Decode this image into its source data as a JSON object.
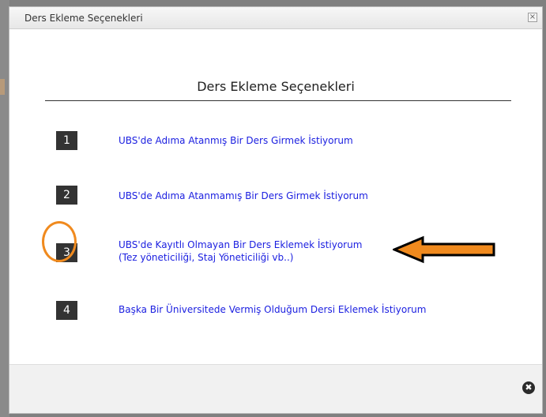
{
  "dialog": {
    "title": "Ders Ekleme Seçenekleri",
    "close_glyph": "×"
  },
  "main": {
    "heading": "Ders Ekleme Seçenekleri",
    "options": [
      {
        "number": "1",
        "lines": [
          "UBS'de Adıma Atanmış Bir Ders Girmek İstiyorum"
        ]
      },
      {
        "number": "2",
        "lines": [
          "UBS'de Adıma Atanmamış Bir Ders Girmek İstiyorum"
        ]
      },
      {
        "number": "3",
        "lines": [
          "UBS'de Kayıtlı Olmayan Bir Ders Eklemek İstiyorum",
          "(Tez yöneticiliği, Staj Yöneticiliği vb..)"
        ]
      },
      {
        "number": "4",
        "lines": [
          "Başka Bir Üniversitede Vermiş Olduğum Dersi Eklemek İstiyorum"
        ]
      }
    ]
  },
  "annotations": {
    "highlight_color": "#f08a1e",
    "arrow_color": "#f08a1e",
    "highlighted_option": "3"
  },
  "footer": {
    "close_glyph": "✖"
  },
  "colors": {
    "link": "#1a1ee0",
    "number_box_bg": "#333333",
    "number_box_fg": "#ffffff"
  },
  "icons": {
    "title_close": "close-icon",
    "footer_close": "close-circle-icon"
  }
}
